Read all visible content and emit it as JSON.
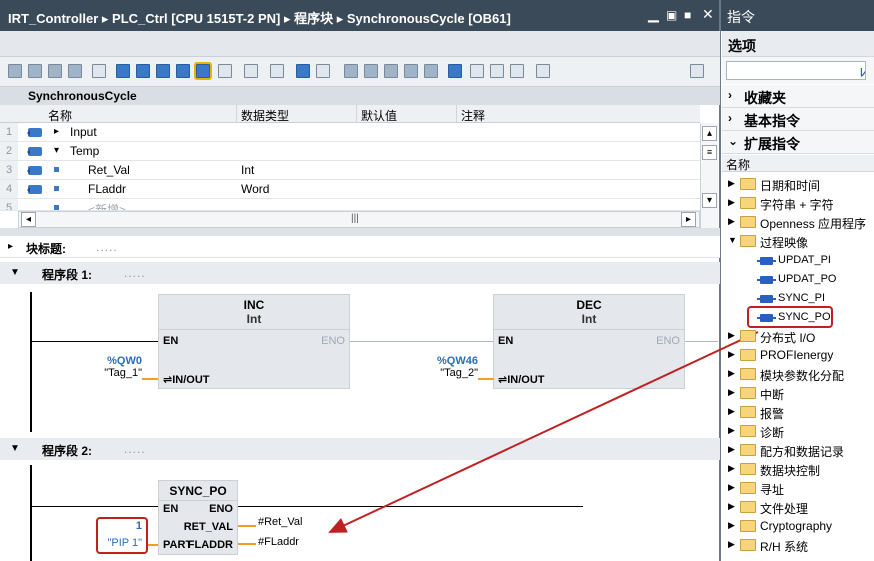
{
  "window": {
    "breadcrumb": "IRT_Controller  ▸  PLC_Ctrl [CPU 1515T-2 PN]  ▸  程序块  ▸  SynchronousCycle [OB61]",
    "win_controls": "_ ▪ ▪ ✕"
  },
  "interface": {
    "title": "SynchronousCycle",
    "columns": [
      "名称",
      "数据类型",
      "默认值",
      "注释"
    ],
    "rows": [
      {
        "num": "1",
        "name": "Input",
        "type": "",
        "expand": "▸"
      },
      {
        "num": "2",
        "name": "Temp",
        "type": "",
        "expand": "▾"
      },
      {
        "num": "3",
        "name": "Ret_Val",
        "type": "Int",
        "expand": ""
      },
      {
        "num": "4",
        "name": "FLaddr",
        "type": "Word",
        "expand": ""
      },
      {
        "num": "5",
        "name": "<新增>",
        "type": "",
        "expand": ""
      }
    ],
    "scroll_mid": "|||"
  },
  "editor": {
    "block_title_label": "块标题:",
    "block_title_dots": ".....",
    "network1": {
      "label": "程序段 1:",
      "dots": ".....",
      "inc": {
        "name": "INC",
        "type": "Int",
        "en": "EN",
        "eno": "ENO",
        "inout": "⇌IN/OUT",
        "addr": "%QW0",
        "tag": "\"Tag_1\""
      },
      "dec": {
        "name": "DEC",
        "type": "Int",
        "en": "EN",
        "eno": "ENO",
        "inout": "⇌IN/OUT",
        "addr": "%QW46",
        "tag": "\"Tag_2\""
      }
    },
    "network2": {
      "label": "程序段 2:",
      "dots": ".....",
      "block": {
        "name": "SYNC_PO",
        "en": "EN",
        "eno": "ENO",
        "ret_val": "RET_VAL",
        "part": "PART",
        "fladdr": "FLADDR"
      },
      "const_1": "1",
      "part_val": "\"PIP 1\"",
      "ret_out": "#Ret_Val",
      "fladdr_out": "#FLaddr"
    }
  },
  "instructions_panel": {
    "title": "指令",
    "options": "选项",
    "sections": {
      "favorites": "收藏夹",
      "basic": "基本指令",
      "extended": "扩展指令"
    },
    "name_header": "名称",
    "tree": [
      {
        "label": "日期和时间"
      },
      {
        "label": "字符串 + 字符"
      },
      {
        "label": "Openness 应用程序"
      },
      {
        "label": "过程映像",
        "open": true,
        "children": [
          "UPDAT_PI",
          "UPDAT_PO",
          "SYNC_PI",
          "SYNC_PO"
        ]
      },
      {
        "label": "分布式 I/O"
      },
      {
        "label": "PROFIenergy"
      },
      {
        "label": "模块参数化分配"
      },
      {
        "label": "中断"
      },
      {
        "label": "报警"
      },
      {
        "label": "诊断"
      },
      {
        "label": "配方和数据记录"
      },
      {
        "label": "数据块控制"
      },
      {
        "label": "寻址"
      },
      {
        "label": "文件处理"
      },
      {
        "label": "Cryptography"
      },
      {
        "label": "R/H 系统"
      }
    ]
  },
  "colors": {
    "accent": "#3a78c8",
    "highlight_red": "#c02020",
    "wire_orange": "#f0a020",
    "title_bg": "#3a4a58"
  }
}
